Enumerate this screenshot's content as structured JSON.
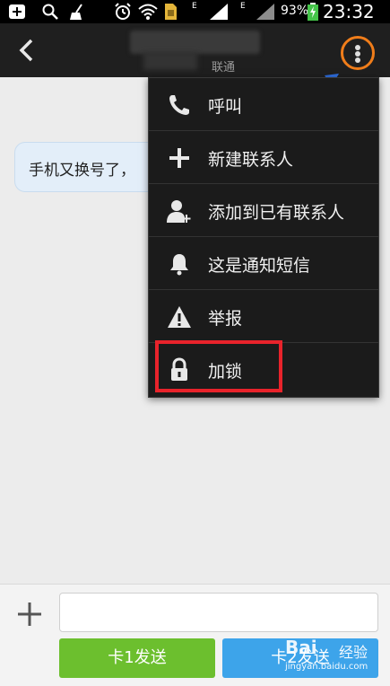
{
  "status_bar": {
    "battery_percent": "93%",
    "time": "23:32",
    "network_label_1": "E",
    "network_label_2": "E",
    "icons": [
      "add-box-icon",
      "search-icon",
      "broom-icon",
      "alarm-icon",
      "wifi-icon",
      "sim-icon",
      "signal-icon",
      "signal-icon",
      "battery-charging-icon"
    ]
  },
  "header": {
    "carrier": "联通",
    "back_icon": "chevron-left-icon",
    "more_icon": "more-vertical-icon"
  },
  "chat": {
    "messages": [
      {
        "text": "手机又换号了，"
      }
    ]
  },
  "menu": {
    "items": [
      {
        "label": "呼叫",
        "icon": "phone-icon"
      },
      {
        "label": "新建联系人",
        "icon": "plus-icon"
      },
      {
        "label": "添加到已有联系人",
        "icon": "person-add-icon"
      },
      {
        "label": "这是通知短信",
        "icon": "bell-icon"
      },
      {
        "label": "举报",
        "icon": "warning-icon"
      },
      {
        "label": "加锁",
        "icon": "lock-icon"
      }
    ]
  },
  "input_bar": {
    "placeholder": "",
    "send1_label": "卡1发送",
    "send2_label": "卡2发送"
  },
  "watermark": {
    "brand": "Bai",
    "product": "经验",
    "url": "jingyan.baidu.com"
  },
  "colors": {
    "highlight": "#e8232b",
    "more_ring": "#f07d1a",
    "send1": "#6cbf2e",
    "send2": "#3da4ea",
    "annotation_arrow": "#2f6fe0"
  }
}
